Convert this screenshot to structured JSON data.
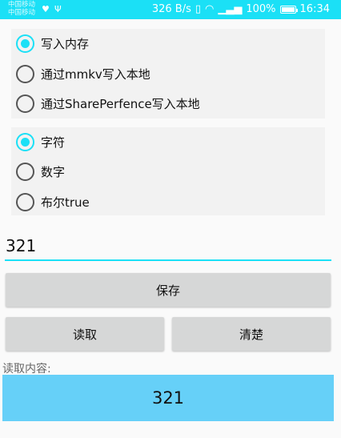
{
  "status_bar": {
    "carrier_1": "中国移动",
    "carrier_2": "中国移动",
    "speed": "326 B/s",
    "battery": "100%",
    "time": "16:34",
    "color": "#1be0f6"
  },
  "storage_options": [
    {
      "label": "写入内存",
      "checked": true
    },
    {
      "label": "通过mmkv写入本地",
      "checked": false
    },
    {
      "label": "通过SharePerfence写入本地",
      "checked": false
    }
  ],
  "type_options": [
    {
      "label": "字符",
      "checked": true
    },
    {
      "label": "数字",
      "checked": false
    },
    {
      "label": "布尔true",
      "checked": false
    }
  ],
  "input": {
    "value": "321"
  },
  "buttons": {
    "save": "保存",
    "read": "读取",
    "clear": "清楚"
  },
  "result": {
    "title": "读取内容:",
    "value": "321"
  },
  "colors": {
    "accent": "#1be0f6",
    "result_bg": "#66d0f8",
    "button_bg": "#d6d7d7"
  }
}
